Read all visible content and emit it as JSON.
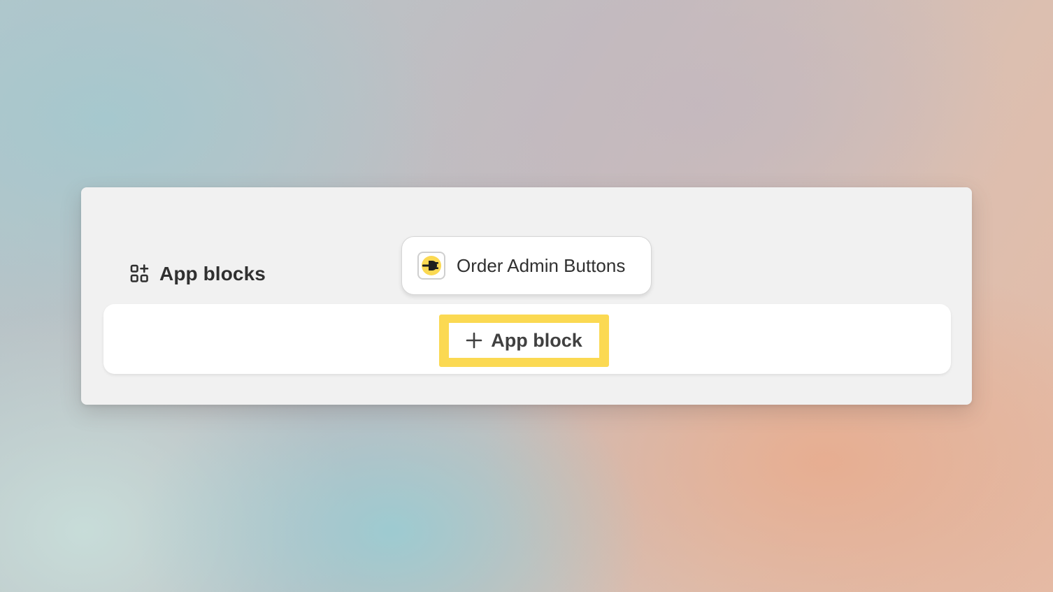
{
  "section": {
    "title": "App blocks",
    "icon": "apps-grid-plus-icon"
  },
  "app_card": {
    "name": "Order Admin Buttons",
    "logo_icon": "plug-icon",
    "logo_color": "#fbd952"
  },
  "add_block": {
    "label": "App block",
    "icon": "plus-icon",
    "highlight_color": "#fbd952"
  }
}
